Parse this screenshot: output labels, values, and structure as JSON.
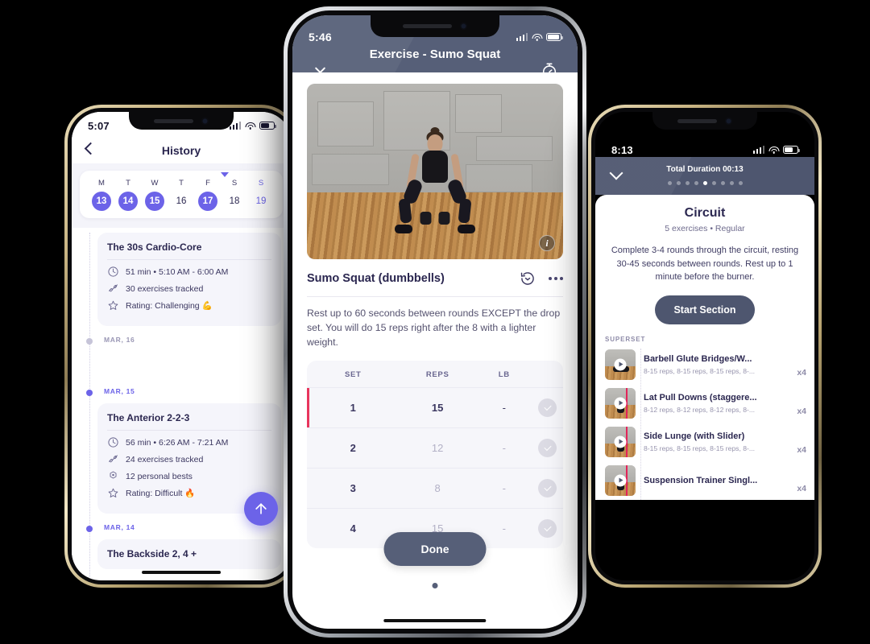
{
  "left_phone": {
    "status": {
      "time": "5:07"
    },
    "header": {
      "title": "History",
      "back_icon": "chevron-left-icon"
    },
    "calendar": {
      "days": [
        {
          "dow": "M",
          "num": "13",
          "selected": true,
          "accent": false
        },
        {
          "dow": "T",
          "num": "14",
          "selected": true,
          "accent": false
        },
        {
          "dow": "W",
          "num": "15",
          "selected": true,
          "accent": false
        },
        {
          "dow": "T",
          "num": "16",
          "selected": false,
          "accent": false
        },
        {
          "dow": "F",
          "num": "17",
          "selected": true,
          "accent": false
        },
        {
          "dow": "S",
          "num": "18",
          "selected": false,
          "accent": false
        },
        {
          "dow": "S",
          "num": "19",
          "selected": false,
          "accent": true
        }
      ]
    },
    "timeline": [
      {
        "date": "",
        "dim": false,
        "card": {
          "title": "The 30s Cardio-Core",
          "rows": [
            {
              "icon": "clock-icon",
              "text": "51 min • 5:10 AM - 6:00 AM"
            },
            {
              "icon": "dumbbell-icon",
              "text": "30 exercises tracked"
            },
            {
              "icon": "star-icon",
              "text": "Rating: Challenging 💪"
            }
          ]
        }
      },
      {
        "date": "MAR, 16",
        "dim": true,
        "card": null
      },
      {
        "date": "MAR, 15",
        "dim": false,
        "card": {
          "title": "The Anterior 2-2-3",
          "rows": [
            {
              "icon": "clock-icon",
              "text": "56 min • 6:26 AM - 7:21 AM"
            },
            {
              "icon": "dumbbell-icon",
              "text": "24 exercises tracked"
            },
            {
              "icon": "medal-icon",
              "text": "12 personal bests"
            },
            {
              "icon": "star-icon",
              "text": "Rating: Difficult 🔥"
            }
          ]
        }
      },
      {
        "date": "MAR, 14",
        "dim": false,
        "card": {
          "title": "The Backside 2, 4 +",
          "rows": []
        }
      }
    ],
    "fab": {
      "icon": "arrow-up-icon"
    }
  },
  "center_phone": {
    "status": {
      "time": "5:46"
    },
    "navbar": {
      "title": "Exercise - Sumo Squat",
      "close_icon": "close-icon",
      "timer_icon": "stopwatch-icon"
    },
    "video": {
      "info_icon": "info-icon"
    },
    "exercise": {
      "name": "Sumo Squat (dumbbells)",
      "history_icon": "history-clock-icon",
      "more_icon": "more-options-icon",
      "note": "Rest up to 60 seconds between rounds EXCEPT the drop set. You will do 15 reps right after the 8 with a lighter weight."
    },
    "sets_table": {
      "columns": [
        "SET",
        "REPS",
        "LB"
      ],
      "rows": [
        {
          "set": "1",
          "reps": "15",
          "lb": "-",
          "active": true,
          "pending": false
        },
        {
          "set": "2",
          "reps": "12",
          "lb": "-",
          "active": false,
          "pending": true
        },
        {
          "set": "3",
          "reps": "8",
          "lb": "-",
          "active": false,
          "pending": true
        },
        {
          "set": "4",
          "reps": "15",
          "lb": "-",
          "active": false,
          "pending": true
        }
      ]
    },
    "done_label": "Done"
  },
  "right_phone": {
    "status": {
      "time": "8:13"
    },
    "header": {
      "duration_label": "Total Duration 00:13",
      "collapse_icon": "chevron-down-icon",
      "dots_total": 9,
      "dots_active_index": 4
    },
    "section": {
      "title": "Circuit",
      "subtitle": "5 exercises • Regular",
      "description": "Complete 3-4 rounds through the circuit, resting 30-45 seconds between rounds. Rest up to 1 minute before the burner.",
      "start_label": "Start Section"
    },
    "group_label": "SUPERSET",
    "exercises": [
      {
        "name": "Barbell Glute Bridges/W...",
        "detail": "8-15 reps, 8-15 reps, 8-15 reps, 8-...",
        "count": "x4",
        "thumb": "glute-bridge",
        "play_icon": "play-icon"
      },
      {
        "name": "Lat Pull Downs (staggere...",
        "detail": "8-12 reps, 8-12 reps, 8-12 reps, 8-...",
        "count": "x4",
        "thumb": "lat-pulldown",
        "play_icon": "play-icon"
      },
      {
        "name": "Side Lunge (with Slider)",
        "detail": "8-15 reps, 8-15 reps, 8-15 reps, 8-...",
        "count": "x4",
        "thumb": "side-lunge",
        "play_icon": "play-icon"
      },
      {
        "name": "Suspension Trainer Singl...",
        "detail": "",
        "count": "x4",
        "thumb": "suspension",
        "play_icon": "play-icon"
      }
    ]
  },
  "theme": {
    "accent": "#6C63E8",
    "dark_slate": "#565f78",
    "dark_slate_right": "#4e566f",
    "text": "#2b2750",
    "background": "#000000",
    "active_marker": "#e8365d"
  }
}
